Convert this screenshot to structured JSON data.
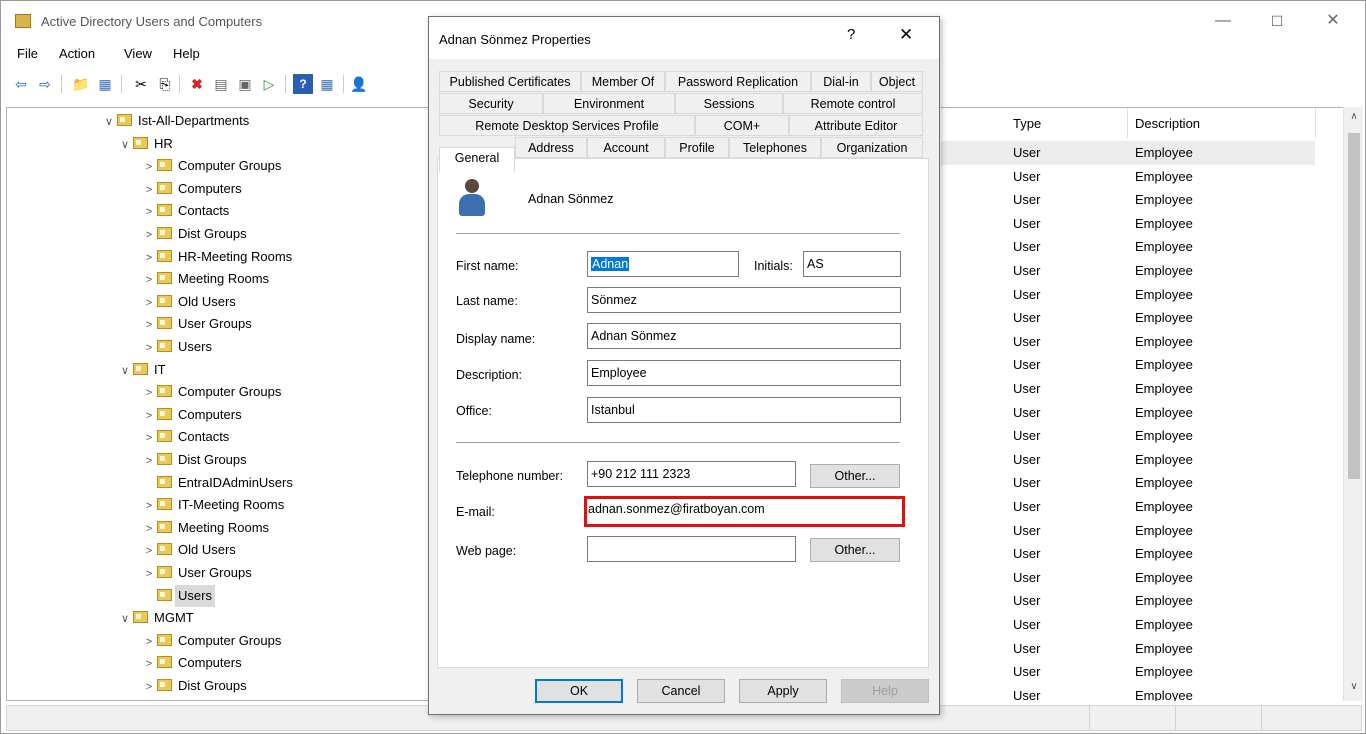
{
  "main": {
    "title": "Active Directory Users and Computers",
    "menu": [
      "File",
      "Action",
      "View",
      "Help"
    ]
  },
  "tree": [
    {
      "label": "Ist-All-Departments",
      "chevron": "∨",
      "level": 0
    },
    {
      "label": "HR",
      "chevron": "∨",
      "level": 1
    },
    {
      "label": "Computer Groups",
      "chevron": ">",
      "level": 2
    },
    {
      "label": "Computers",
      "chevron": ">",
      "level": 2
    },
    {
      "label": "Contacts",
      "chevron": ">",
      "level": 2
    },
    {
      "label": "Dist Groups",
      "chevron": ">",
      "level": 2
    },
    {
      "label": "HR-Meeting Rooms",
      "chevron": ">",
      "level": 2
    },
    {
      "label": "Meeting Rooms",
      "chevron": ">",
      "level": 2
    },
    {
      "label": "Old Users",
      "chevron": ">",
      "level": 2
    },
    {
      "label": "User Groups",
      "chevron": ">",
      "level": 2
    },
    {
      "label": "Users",
      "chevron": ">",
      "level": 2
    },
    {
      "label": "IT",
      "chevron": "∨",
      "level": 1
    },
    {
      "label": "Computer Groups",
      "chevron": ">",
      "level": 2
    },
    {
      "label": "Computers",
      "chevron": ">",
      "level": 2
    },
    {
      "label": "Contacts",
      "chevron": ">",
      "level": 2
    },
    {
      "label": "Dist Groups",
      "chevron": ">",
      "level": 2
    },
    {
      "label": "EntraIDAdminUsers",
      "chevron": "",
      "level": 2
    },
    {
      "label": "IT-Meeting Rooms",
      "chevron": ">",
      "level": 2
    },
    {
      "label": "Meeting Rooms",
      "chevron": ">",
      "level": 2
    },
    {
      "label": "Old Users",
      "chevron": ">",
      "level": 2
    },
    {
      "label": "User Groups",
      "chevron": ">",
      "level": 2
    },
    {
      "label": "Users",
      "chevron": "",
      "level": 2,
      "selected": true
    },
    {
      "label": "MGMT",
      "chevron": "∨",
      "level": 1
    },
    {
      "label": "Computer Groups",
      "chevron": ">",
      "level": 2
    },
    {
      "label": "Computers",
      "chevron": ">",
      "level": 2
    },
    {
      "label": "Dist Groups",
      "chevron": ">",
      "level": 2
    }
  ],
  "list": {
    "columns": [
      "Type",
      "Description"
    ],
    "rows": [
      [
        "User",
        "Employee"
      ],
      [
        "User",
        "Employee"
      ],
      [
        "User",
        "Employee"
      ],
      [
        "User",
        "Employee"
      ],
      [
        "User",
        "Employee"
      ],
      [
        "User",
        "Employee"
      ],
      [
        "User",
        "Employee"
      ],
      [
        "User",
        "Employee"
      ],
      [
        "User",
        "Employee"
      ],
      [
        "User",
        "Employee"
      ],
      [
        "User",
        "Employee"
      ],
      [
        "User",
        "Employee"
      ],
      [
        "User",
        "Employee"
      ],
      [
        "User",
        "Employee"
      ],
      [
        "User",
        "Employee"
      ],
      [
        "User",
        "Employee"
      ],
      [
        "User",
        "Employee"
      ],
      [
        "User",
        "Employee"
      ],
      [
        "User",
        "Employee"
      ],
      [
        "User",
        "Employee"
      ],
      [
        "User",
        "Employee"
      ],
      [
        "User",
        "Employee"
      ],
      [
        "User",
        "Employee"
      ],
      [
        "User",
        "Employee"
      ]
    ]
  },
  "dialog": {
    "title": "Adnan Sönmez Properties",
    "help_glyph": "?",
    "close_glyph": "✕",
    "tabs_row1": [
      "Published Certificates",
      "Member Of",
      "Password Replication",
      "Dial-in",
      "Object"
    ],
    "tabs_row2": [
      "Security",
      "Environment",
      "Sessions",
      "Remote control"
    ],
    "tabs_row3": [
      "Remote Desktop Services Profile",
      "COM+",
      "Attribute Editor"
    ],
    "tabs_row4": [
      "General",
      "Address",
      "Account",
      "Profile",
      "Telephones",
      "Organization"
    ],
    "user_display": "Adnan Sönmez",
    "labels": {
      "first_name": "First name:",
      "initials": "Initials:",
      "last_name": "Last name:",
      "display_name": "Display name:",
      "description": "Description:",
      "office": "Office:",
      "telephone": "Telephone number:",
      "email": "E-mail:",
      "web_page": "Web page:"
    },
    "values": {
      "first_name": "Adnan",
      "initials": "AS",
      "last_name": "Sönmez",
      "display_name": "Adnan Sönmez",
      "description": "Employee",
      "office": "Istanbul",
      "telephone": "+90 212 111 2323",
      "email": "adnan.sonmez@firatboyan.com",
      "web_page": ""
    },
    "other_label": "Other...",
    "buttons": {
      "ok": "OK",
      "cancel": "Cancel",
      "apply": "Apply",
      "help": "Help"
    }
  }
}
